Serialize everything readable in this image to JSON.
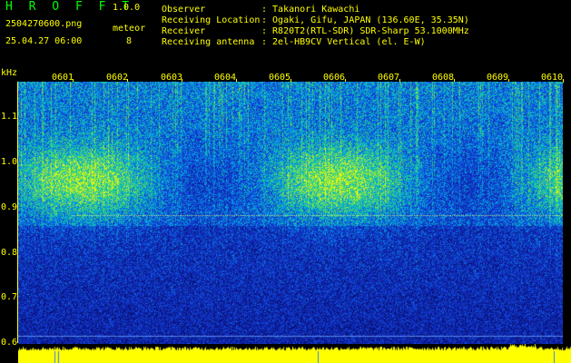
{
  "header": {
    "app_title": "H R O F F T",
    "app_version": "1.0.0",
    "file_name": "2504270600.png",
    "datetime": "25.04.27 06:00",
    "meteor_label": "meteor",
    "meteor_count": "8",
    "info": [
      {
        "key": "Observer",
        "value": ": Takanori Kawachi"
      },
      {
        "key": "Receiving Location",
        "value": ": Ogaki, Gifu, JAPAN (136.60E, 35.35N)"
      },
      {
        "key": "Receiver",
        "value": ": R820T2(RTL-SDR) SDR-Sharp 53.1000MHz"
      },
      {
        "key": "Receiving antenna",
        "value": ": 2el-HB9CV Vertical (el. E-W)"
      }
    ]
  },
  "axes": {
    "y_unit": "kHz",
    "y_ticks": [
      "1.1",
      "1.0",
      "0.9",
      "0.8",
      "0.7",
      "0.6"
    ],
    "x_ticks": [
      "0601",
      "0602",
      "0603",
      "0604",
      "0605",
      "0606",
      "0607",
      "0608",
      "0609",
      "0610"
    ]
  },
  "colors": {
    "text": "#ffff00",
    "title": "#00ff00",
    "background": "#000000",
    "spectrum_low": "#0a1a8a",
    "spectrum_high": "#ffff00",
    "meteor_bar": "#ffff00"
  }
}
